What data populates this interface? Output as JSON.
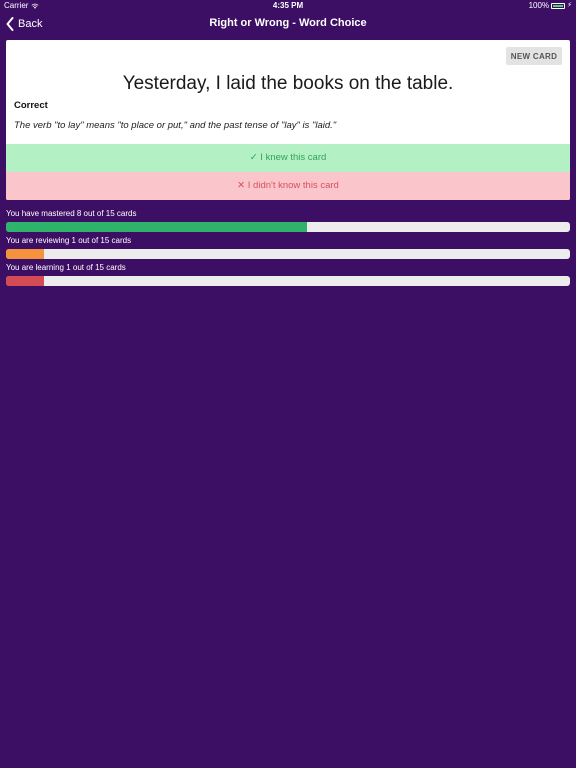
{
  "status_bar": {
    "carrier": "Carrier",
    "time": "4:35 PM",
    "battery": "100%",
    "icons": [
      "wifi-icon",
      "battery-icon",
      "bolt-icon"
    ]
  },
  "nav": {
    "back_label": "Back",
    "title": "Right or Wrong - Word Choice"
  },
  "card": {
    "new_card_label": "NEW CARD",
    "sentence": "Yesterday, I laid the books on the table.",
    "verdict": "Correct",
    "explanation": "The verb \"to lay\" means \"to place or put,\" and the past tense of \"lay\" is \"laid.\"",
    "knew_label": "✓ I knew this card",
    "didnt_know_label": "✕ I didn't know this card"
  },
  "progress": [
    {
      "label": "You have mastered 8 out of 15 cards",
      "value": 8,
      "total": 15,
      "color": "#2fb36b"
    },
    {
      "label": "You are reviewing 1 out of 15 cards",
      "value": 1,
      "total": 15,
      "color": "#f5923e"
    },
    {
      "label": "You are learning 1 out of 15 cards",
      "value": 1,
      "total": 15,
      "color": "#d44a55"
    }
  ],
  "colors": {
    "background": "#3d0f64",
    "knew_bg": "#b3f0c3",
    "knew_text": "#2fa65a",
    "didnt_bg": "#fac6cb",
    "didnt_text": "#d9505d",
    "track": "#ececec"
  }
}
